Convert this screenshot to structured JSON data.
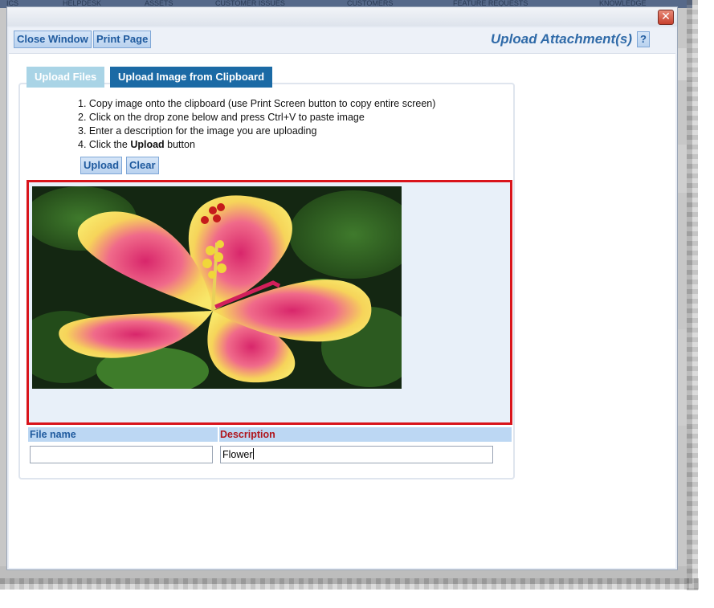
{
  "background_app": {
    "tabs": [
      "ICS",
      "HELPDESK",
      "ASSETS",
      "CUSTOMER ISSUES",
      "CUSTOMERS",
      "FEATURE REQUESTS",
      "KNOWLEDGE"
    ]
  },
  "dialog": {
    "close_symbol": "✕",
    "toolbar": {
      "close_window_label": "Close Window",
      "print_page_label": "Print Page",
      "title": "Upload Attachment(s)",
      "help_label": "?"
    },
    "tabs": [
      {
        "label": "Upload Files",
        "active": false
      },
      {
        "label": "Upload Image from Clipboard",
        "active": true
      }
    ],
    "steps": [
      "1. Copy image onto the clipboard (use Print Screen button to copy entire screen)",
      "2. Click on the drop zone below and press Ctrl+V to paste image",
      "3. Enter a description for the image you are uploading"
    ],
    "step4": {
      "prefix": "4. Click the ",
      "bold": "Upload",
      "suffix": " button"
    },
    "buttons": {
      "upload_label": "Upload",
      "clear_label": "Clear"
    },
    "dropzone": {
      "border_color": "#d9141b",
      "image_subject": "hibiscus-flower"
    },
    "fields": {
      "file_name_header": "File name",
      "description_header": "Description",
      "file_name_value": "",
      "description_value": "Flower"
    }
  },
  "colors": {
    "accent_blue": "#1f5a9e",
    "active_tab": "#1b6aa5",
    "inactive_tab": "#a9d4e6",
    "title_blue": "#2f6aa8",
    "description_red": "#b0161c"
  }
}
